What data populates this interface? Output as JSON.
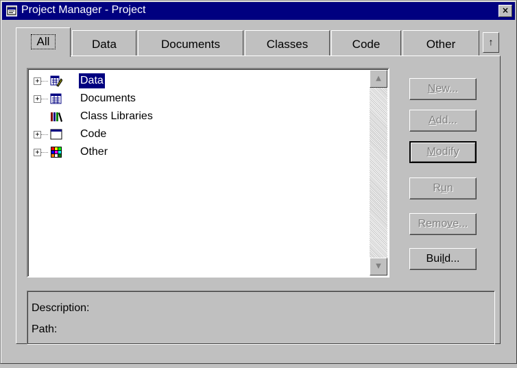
{
  "window": {
    "title": "Project Manager - Project",
    "close_glyph": "×"
  },
  "tabs": [
    {
      "label": "All",
      "active": true
    },
    {
      "label": "Data"
    },
    {
      "label": "Documents"
    },
    {
      "label": "Classes"
    },
    {
      "label": "Code"
    },
    {
      "label": "Other"
    }
  ],
  "tab_scroll_glyph": "↑",
  "tree": {
    "items": [
      {
        "label": "Data",
        "icon": "data-icon",
        "expandable": true,
        "selected": true
      },
      {
        "label": "Documents",
        "icon": "documents-icon",
        "expandable": true
      },
      {
        "label": "Class Libraries",
        "icon": "class-libraries-icon",
        "expandable": false
      },
      {
        "label": "Code",
        "icon": "code-icon",
        "expandable": true
      },
      {
        "label": "Other",
        "icon": "other-icon",
        "expandable": true
      }
    ],
    "expand_glyph": "+",
    "scroll_up_glyph": "▲",
    "scroll_down_glyph": "▼"
  },
  "buttons": {
    "new": {
      "pre": "",
      "key": "N",
      "post": "ew..."
    },
    "add": {
      "pre": "",
      "key": "A",
      "post": "dd..."
    },
    "modify": {
      "pre": "",
      "key": "M",
      "post": "odify"
    },
    "run": {
      "pre": "R",
      "key": "u",
      "post": "n"
    },
    "remove": {
      "pre": "Remo",
      "key": "v",
      "post": "e..."
    },
    "build": {
      "pre": "Bui",
      "key": "l",
      "post": "d..."
    }
  },
  "description": {
    "description_label": "Description:",
    "path_label": "Path:"
  },
  "colors": {
    "titlebar": "#000080",
    "face": "#c0c0c0",
    "selection": "#000080"
  }
}
